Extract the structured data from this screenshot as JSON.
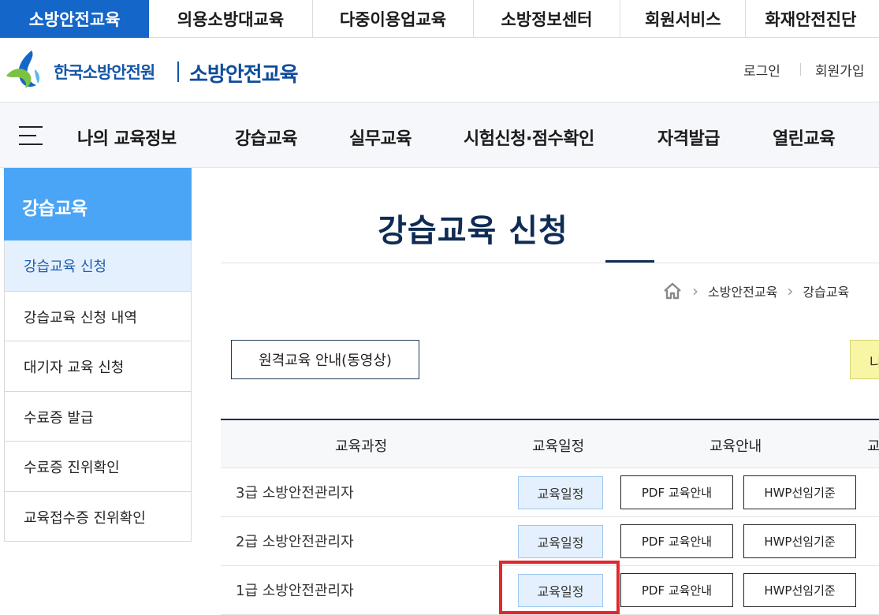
{
  "topnav": {
    "items": [
      {
        "label": "소방안전교육",
        "active": true
      },
      {
        "label": "의용소방대교육",
        "active": false
      },
      {
        "label": "다중이용업교육",
        "active": false
      },
      {
        "label": "소방정보센터",
        "active": false
      },
      {
        "label": "회원서비스",
        "active": false
      },
      {
        "label": "화재안전진단",
        "active": false
      }
    ]
  },
  "header": {
    "org_name": "한국소방안전원",
    "site_name": "소방안전교육",
    "login": "로그인",
    "signup": "회원가입"
  },
  "gnb": {
    "items": [
      "나의 교육정보",
      "강습교육",
      "실무교육",
      "시험신청·점수확인",
      "자격발급",
      "열린교육"
    ]
  },
  "sidebar": {
    "title": "강습교육",
    "items": [
      {
        "label": "강습교육 신청",
        "active": true
      },
      {
        "label": "강습교육 신청 내역",
        "active": false
      },
      {
        "label": "대기자 교육 신청",
        "active": false
      },
      {
        "label": "수료증 발급",
        "active": false
      },
      {
        "label": "수료증 진위확인",
        "active": false
      },
      {
        "label": "교육접수증 진위확인",
        "active": false
      }
    ]
  },
  "main": {
    "title": "강습교육 신청",
    "breadcrumb": [
      "소방안전교육",
      "강습교육"
    ],
    "remote_button": "원격교육 안내(동영상)",
    "yellow_button": "나",
    "table": {
      "headers": [
        "교육과정",
        "교육일정",
        "교육안내",
        "교"
      ],
      "rows": [
        {
          "name": "3급 소방안전관리자",
          "schedule": "교육일정",
          "pdf": "PDF 교육안내",
          "hwp": "HWP선임기준"
        },
        {
          "name": "2급 소방안전관리자",
          "schedule": "교육일정",
          "pdf": "PDF 교육안내",
          "hwp": "HWP선임기준"
        },
        {
          "name": "1급 소방안전관리자",
          "schedule": "교육일정",
          "pdf": "PDF 교육안내",
          "hwp": "HWP선임기준"
        }
      ]
    }
  },
  "colors": {
    "primary": "#1466c9",
    "sidebar_title": "#4aa5f6",
    "navy": "#0f2c55",
    "highlight": "#e0282e"
  },
  "icons": {
    "logo": "fire-safety-logo-icon",
    "menu": "hamburger-menu-icon",
    "home": "home-icon",
    "chevron": "chevron-right-icon"
  }
}
